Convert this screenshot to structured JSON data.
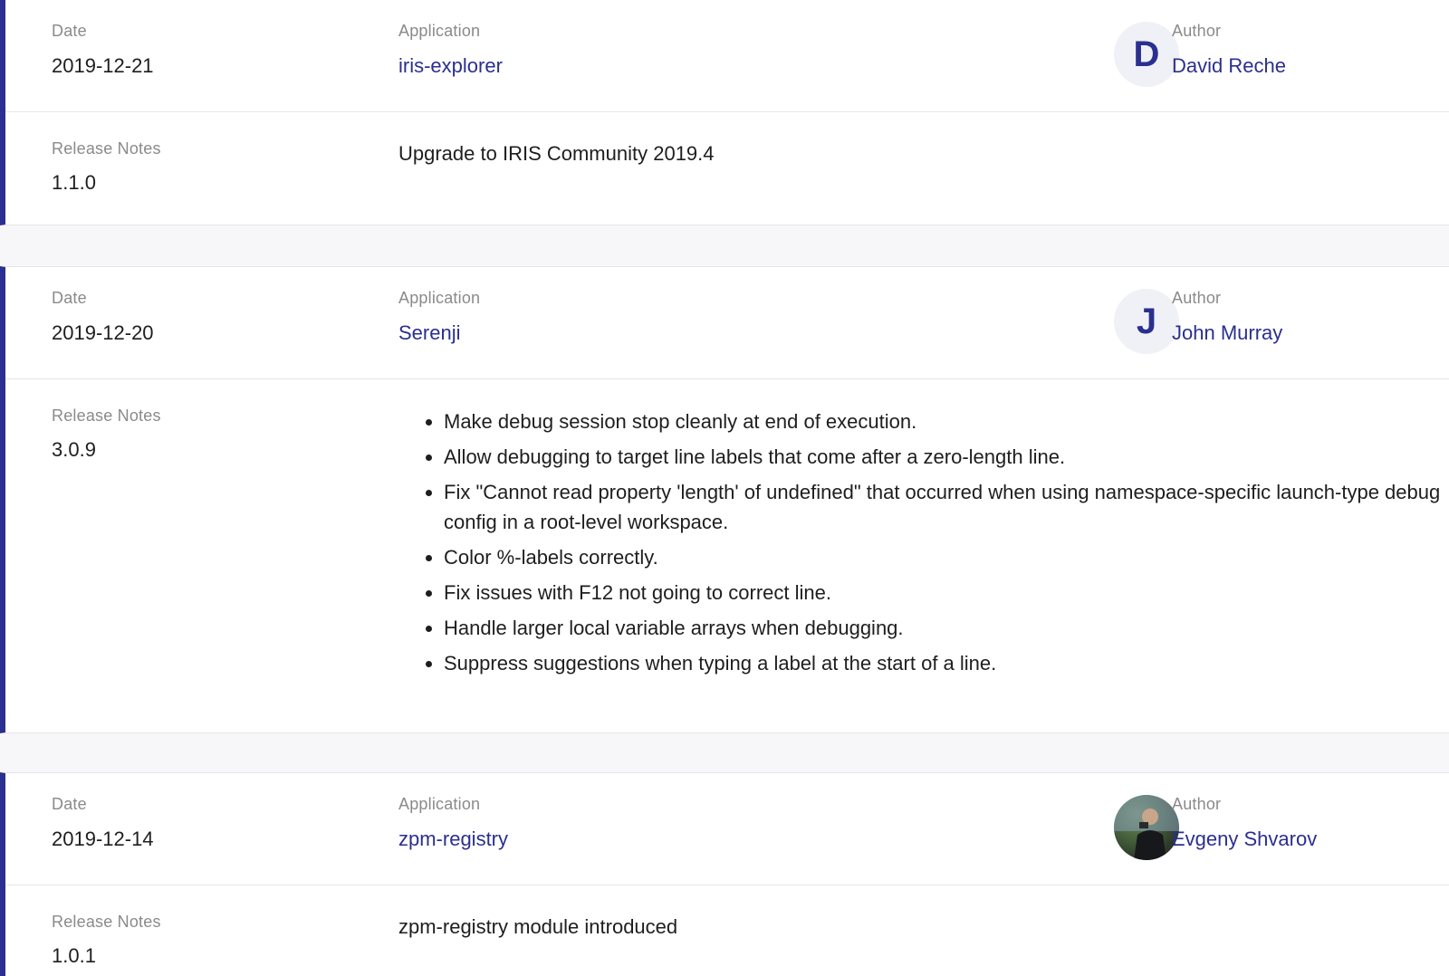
{
  "labels": {
    "date": "Date",
    "application": "Application",
    "author": "Author",
    "release_notes": "Release Notes"
  },
  "releases": [
    {
      "date": "2019-12-21",
      "application": "iris-explorer",
      "author": "David Reche",
      "avatar_initial": "D",
      "version": "1.1.0",
      "notes_text": "Upgrade to IRIS Community 2019.4"
    },
    {
      "date": "2019-12-20",
      "application": "Serenji",
      "author": "John Murray",
      "avatar_initial": "J",
      "version": "3.0.9",
      "notes_list": [
        "Make debug session stop cleanly at end of execution.",
        "Allow debugging to target line labels that come after a zero-length line.",
        "Fix \"Cannot read property 'length' of undefined\" that occurred when using namespace-specific launch-type debug config in a root-level workspace.",
        "Color %-labels correctly.",
        "Fix issues with F12 not going to correct line.",
        "Handle larger local variable arrays when debugging.",
        "Suppress suggestions when typing a label at the start of a line."
      ]
    },
    {
      "date": "2019-12-14",
      "application": "zpm-registry",
      "author": "Evgeny Shvarov",
      "avatar_initial": "",
      "version": "1.0.1",
      "notes_text": "zpm-registry module introduced"
    }
  ],
  "colors": {
    "accent": "#2b2f8f",
    "label": "#8a8a8a",
    "text": "#1e1e1e",
    "divider": "#e6e6ea"
  }
}
